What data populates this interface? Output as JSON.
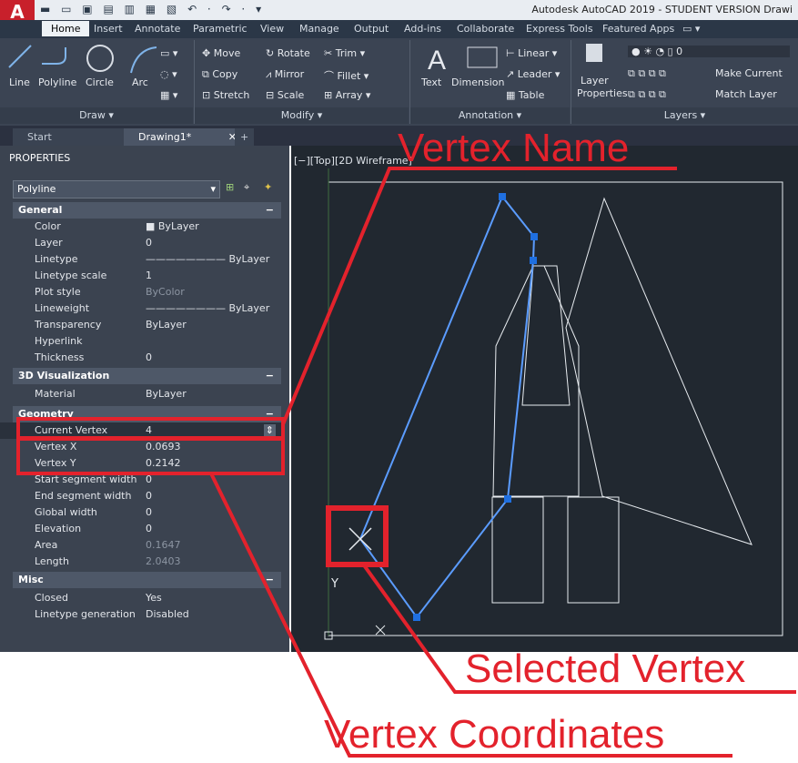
{
  "titlebar": {
    "app_letter": "A",
    "title": "Autodesk AutoCAD 2019 - STUDENT VERSION   Drawi"
  },
  "ribbon_tabs": [
    "Home",
    "Insert",
    "Annotate",
    "Parametric",
    "View",
    "Manage",
    "Output",
    "Add-ins",
    "Collaborate",
    "Express Tools",
    "Featured Apps"
  ],
  "draw_panel": {
    "line": "Line",
    "polyline": "Polyline",
    "circle": "Circle",
    "arc": "Arc",
    "label": "Draw ▾"
  },
  "modify_panel": {
    "move": "Move",
    "rotate": "Rotate",
    "trim": "Trim",
    "copy": "Copy",
    "mirror": "Mirror",
    "fillet": "Fillet",
    "stretch": "Stretch",
    "scale": "Scale",
    "array": "Array",
    "label": "Modify ▾"
  },
  "annotation_panel": {
    "text": "Text",
    "dimension": "Dimension",
    "linear": "Linear",
    "leader": "Leader",
    "table": "Table",
    "label": "Annotation ▾"
  },
  "layers_panel": {
    "layer_properties_1": "Layer",
    "layer_properties_2": "Properties",
    "layer_value": "0",
    "make_current": "Make Current",
    "match_layer": "Match Layer",
    "label": "Layers ▾"
  },
  "file_tabs": {
    "start": "Start",
    "drawing": "Drawing1*"
  },
  "properties": {
    "header": "PROPERTIES",
    "object_type": "Polyline",
    "general": {
      "title": "General",
      "rows": [
        {
          "label": "Color",
          "value": "ByLayer"
        },
        {
          "label": "Layer",
          "value": "0"
        },
        {
          "label": "Linetype",
          "value": "ByLayer"
        },
        {
          "label": "Linetype scale",
          "value": "1"
        },
        {
          "label": "Plot style",
          "value": "ByColor"
        },
        {
          "label": "Lineweight",
          "value": "ByLayer"
        },
        {
          "label": "Transparency",
          "value": "ByLayer"
        },
        {
          "label": "Hyperlink",
          "value": ""
        },
        {
          "label": "Thickness",
          "value": "0"
        }
      ]
    },
    "visualization": {
      "title": "3D Visualization",
      "rows": [
        {
          "label": "Material",
          "value": "ByLayer"
        }
      ]
    },
    "geometry": {
      "title": "Geometry",
      "rows": [
        {
          "label": "Current Vertex",
          "value": "4"
        },
        {
          "label": "Vertex X",
          "value": "0.0693"
        },
        {
          "label": "Vertex Y",
          "value": "0.2142"
        },
        {
          "label": "Start segment width",
          "value": "0"
        },
        {
          "label": "End segment width",
          "value": "0"
        },
        {
          "label": "Global width",
          "value": "0"
        },
        {
          "label": "Elevation",
          "value": "0"
        },
        {
          "label": "Area",
          "value": "0.1647"
        },
        {
          "label": "Length",
          "value": "2.0403"
        }
      ]
    },
    "misc": {
      "title": "Misc",
      "rows": [
        {
          "label": "Closed",
          "value": "Yes"
        },
        {
          "label": "Linetype generation",
          "value": "Disabled"
        }
      ]
    }
  },
  "viewport": {
    "label": "[−][Top][2D Wireframe]",
    "axis_y": "Y"
  },
  "annotations": {
    "vertex_name": "Vertex Name",
    "selected_vertex": "Selected Vertex",
    "vertex_coordinates": "Vertex Coordinates"
  },
  "colors": {
    "accent_red": "#e3222c",
    "selection_blue": "#3a7fe0",
    "viewport_bg": "#212830",
    "panel_bg": "#3b4350"
  }
}
